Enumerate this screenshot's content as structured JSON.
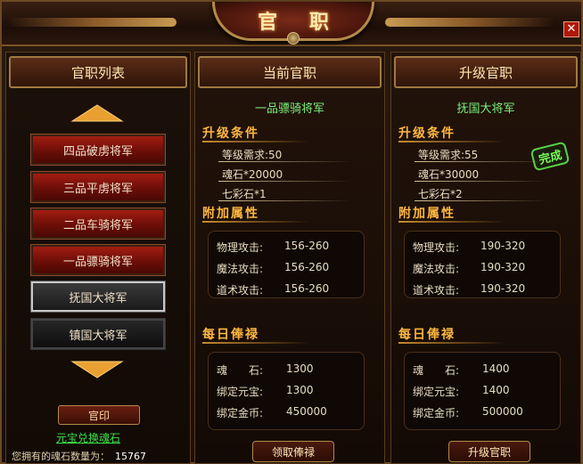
{
  "window": {
    "title": "官 职"
  },
  "left": {
    "header": "官职列表",
    "ranks": [
      "四品破虏将军",
      "三品平虏将军",
      "二品车骑将军",
      "一品骠骑将军",
      "抚国大将军",
      "镇国大将军"
    ],
    "seal_button": "官印",
    "exchange_link": "元宝兑换魂石",
    "soul_count_label": "您拥有的魂石数量为：",
    "soul_count_value": "15767"
  },
  "current": {
    "header": "当前官职",
    "rank_name": "一品骠骑将军",
    "upgrade_title": "升级条件",
    "reqs": [
      "等级需求:50",
      "魂石*20000",
      "七彩石*1"
    ],
    "attr_title": "附加属性",
    "attrs": [
      {
        "label": "物理攻击:",
        "value": "156-260"
      },
      {
        "label": "魔法攻击:",
        "value": "156-260"
      },
      {
        "label": "道术攻击:",
        "value": "156-260"
      }
    ],
    "salary_title": "每日俸禄",
    "salary": [
      {
        "label": "魂　　石:",
        "value": "1300"
      },
      {
        "label": "绑定元宝:",
        "value": "1300"
      },
      {
        "label": "绑定金币:",
        "value": "450000"
      }
    ],
    "action_button": "领取俸禄"
  },
  "upgrade": {
    "header": "升级官职",
    "rank_name": "抚国大将军",
    "upgrade_title": "升级条件",
    "done_stamp": "完成",
    "reqs": [
      "等级需求:55",
      "魂石*30000",
      "七彩石*2"
    ],
    "attr_title": "附加属性",
    "attrs": [
      {
        "label": "物理攻击:",
        "value": "190-320"
      },
      {
        "label": "魔法攻击:",
        "value": "190-320"
      },
      {
        "label": "道术攻击:",
        "value": "190-320"
      }
    ],
    "salary_title": "每日俸禄",
    "salary": [
      {
        "label": "魂　　石:",
        "value": "1400"
      },
      {
        "label": "绑定元宝:",
        "value": "1400"
      },
      {
        "label": "绑定金币:",
        "value": "500000"
      }
    ],
    "action_button": "升级官职"
  },
  "colors": {
    "accent_gold": "#ffb840",
    "rank_green": "#7cf07a",
    "button_red": "#a21d12",
    "link_green": "#3ae04a"
  }
}
